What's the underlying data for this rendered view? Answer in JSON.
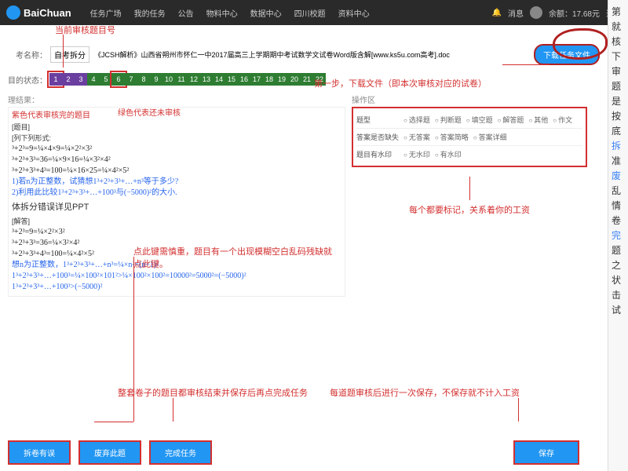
{
  "topnav": {
    "brand": "BaiChuan",
    "items": [
      "任务广场",
      "我的任务",
      "公告",
      "物料中心",
      "数据中心",
      "四川校题",
      "资料中心"
    ],
    "bell": "消息",
    "balance_label": "余额：17.68元",
    "logout": "退出"
  },
  "name_row": {
    "label": "考名称：",
    "cat": "自考拆分",
    "desc": "《JCSH解析》山西省朔州市怀仁一中2017届高三上学期期中考试数学文试卷Word版含解[www.ks5u.com高考].doc"
  },
  "download_btn": "下载任务文件",
  "status_label": "目的状态：",
  "questions": [
    {
      "n": "1",
      "c": "purple",
      "hi": true
    },
    {
      "n": "2",
      "c": "purple"
    },
    {
      "n": "3",
      "c": "purple"
    },
    {
      "n": "4",
      "c": "green"
    },
    {
      "n": "5",
      "c": "green"
    },
    {
      "n": "6",
      "c": "green",
      "hi": true
    },
    {
      "n": "7",
      "c": "green"
    },
    {
      "n": "8",
      "c": "green"
    },
    {
      "n": "9",
      "c": "green"
    },
    {
      "n": "10",
      "c": "green"
    },
    {
      "n": "11",
      "c": "green"
    },
    {
      "n": "12",
      "c": "green"
    },
    {
      "n": "13",
      "c": "green"
    },
    {
      "n": "14",
      "c": "green"
    },
    {
      "n": "15",
      "c": "green"
    },
    {
      "n": "16",
      "c": "green"
    },
    {
      "n": "17",
      "c": "green"
    },
    {
      "n": "18",
      "c": "green"
    },
    {
      "n": "19",
      "c": "green"
    },
    {
      "n": "20",
      "c": "green"
    },
    {
      "n": "21",
      "c": "green"
    },
    {
      "n": "22",
      "c": "green"
    }
  ],
  "result_label": "理结果：",
  "left_content": {
    "purple_note": "紫色代表审核完的题目",
    "green_note": "绿色代表还未审核",
    "header1": "[题目]",
    "header2": "[列下列形式:",
    "line1": "³+2³=9=¼×4×9=¼×2²×3²",
    "line2": "³+2³+3³=36=¼×9×16=¼×3²×4²",
    "line3": "³+2³+3³+4³=100=¼×16×25=¼×4²×5²",
    "q1": "1)若n为正整数，试猜想1³+2³+3³+…+n³等于多少?",
    "q2": "2)利用此比较1³+2³+3³+…+100³与(−5000)²的大小.",
    "ppt_line": "体拆分错误详见PPT",
    "header3": "[解答]",
    "sol1": "³+2³=9=¼×2²×3²",
    "sol2": "³+2³+3³=36=¼×3²×4²",
    "sol3": "³+2³+3³+4³=100=¼×4²×5²",
    "sol4": "想n为正整数，1³+2³+3³+…+n³=¼×n²×(n+1)²",
    "sol5": "1³+2³+3³+…+100³=¼×100²×101²>¼×100²×100²=10000²=5000²=(−5000)²",
    "sol6": "1³+2³+3³+…+100³>(−5000)²"
  },
  "op_panel": {
    "title": "操作区",
    "rows": [
      {
        "label": "题型",
        "opts": [
          "选择题",
          "判断题",
          "填空题",
          "解答题",
          "其他",
          "作文"
        ]
      },
      {
        "label": "答案是否缺失",
        "opts": [
          "无答案",
          "答案简略",
          "答案详细"
        ]
      },
      {
        "label": "题目有水印",
        "opts": [
          "无水印",
          "有水印"
        ]
      }
    ]
  },
  "annotations": {
    "a1": "当前审核题目号",
    "a2": "第一步，下载文件（即本次审核对应的试卷）",
    "a3": "每个都要标记，关系着你的工资",
    "a4": "点此键需慎重，题目有一个出现模糊空白乱码残缺就点此键。",
    "a5": "整套卷子的题目都审核结束并保存后再点完成任务",
    "a6": "每道题审核后进行一次保存，不保存就不计入工资"
  },
  "buttons": {
    "b1": "拆卷有误",
    "b2": "废弃此题",
    "b3": "完成任务",
    "b4": "保存"
  },
  "sidebar_chars": [
    "第",
    "就",
    "核",
    "",
    "下",
    "审",
    "题",
    "是",
    "",
    "按",
    "底",
    "拆",
    "准",
    "废",
    "乱",
    "情",
    "卷",
    "完",
    "题",
    "之",
    "状",
    "击",
    "试"
  ],
  "sidebar_blue": [
    11,
    13,
    17
  ]
}
